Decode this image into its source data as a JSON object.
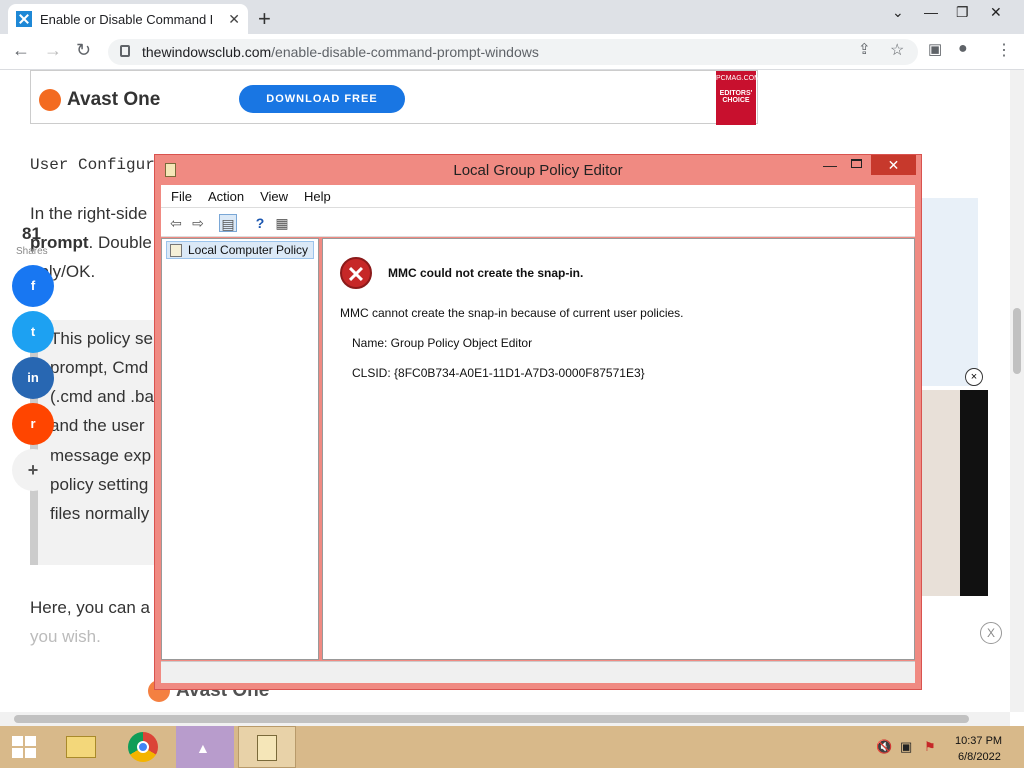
{
  "browser": {
    "tab_title": "Enable or Disable Command Pro",
    "tab_close": "✕",
    "new_tab": "+",
    "url_domain": "thewindowsclub.com",
    "url_path": "/enable-disable-command-prompt-windows"
  },
  "page": {
    "ad_top": {
      "brand": "Avast One",
      "button": "DOWNLOAD FREE",
      "badge_line1": "PCMAG.COM",
      "badge_line2": "EDITORS' CHOICE"
    },
    "code_line": "User Configur",
    "para1_a": "In the right-side",
    "para1_b": "prompt",
    "para1_c": ". Double",
    "para1_d": "pply/OK.",
    "quote_lines": [
      "This policy se",
      "prompt, Cmd",
      "(.cmd and .ba",
      "and the user",
      "message exp",
      "policy setting",
      "files normally"
    ],
    "para2": "Here, you can a",
    "para3": "you wish.",
    "share_count": "81",
    "share_label": "Shares",
    "social": {
      "facebook": "f",
      "twitter": "t",
      "linkedin": "in",
      "reddit": "r",
      "more": "+"
    },
    "ad_bottom": {
      "brand": "Avast One"
    },
    "close_video": "×",
    "close_ad": "X"
  },
  "dialog": {
    "title": "Local Group Policy Editor",
    "min": "—",
    "close": "✕",
    "menu": [
      "File",
      "Action",
      "View",
      "Help"
    ],
    "tree_item": "Local Computer Policy",
    "error_title": "MMC could not create the snap-in.",
    "error_message": "MMC cannot create the snap-in because of current user policies.",
    "name_line": "Name: Group Policy Object Editor",
    "clsid_line": "CLSID: {8FC0B734-A0E1-11D1-A7D3-0000F87571E3}"
  },
  "taskbar": {
    "time": "10:37 PM",
    "date": "6/8/2022"
  },
  "colors": {
    "dialog_frame": "#f08a82",
    "close_red": "#c7392c",
    "taskbar": "#d8b98a",
    "download_blue": "#1976e3",
    "avast_orange": "#f36b21"
  }
}
